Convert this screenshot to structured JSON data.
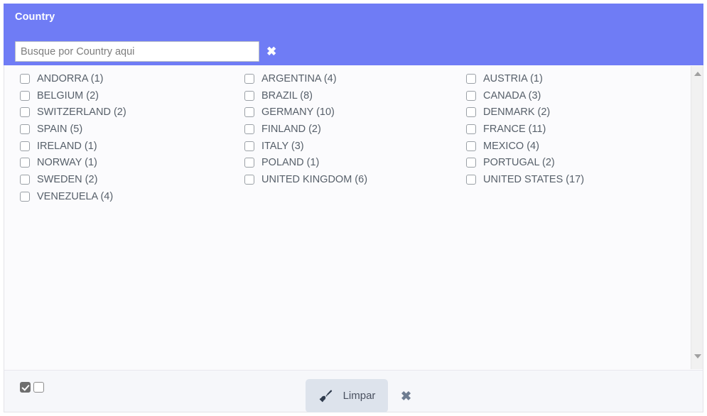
{
  "panel": {
    "title": "Country",
    "accent_color": "#6f7cf5",
    "body_background": "#fbfbfd",
    "footer_background": "#f6f7fa"
  },
  "search": {
    "value": "",
    "placeholder": "Busque por Country aqui",
    "clear_icon": "close-x-icon",
    "clear_icon_glyph": "✖"
  },
  "options": {
    "columns": [
      {
        "items": [
          {
            "label": "ANDORRA (1)",
            "name": "ANDORRA",
            "count": 1,
            "checked": false
          },
          {
            "label": "BELGIUM (2)",
            "name": "BELGIUM",
            "count": 2,
            "checked": false
          },
          {
            "label": "SWITZERLAND (2)",
            "name": "SWITZERLAND",
            "count": 2,
            "checked": false
          },
          {
            "label": "SPAIN (5)",
            "name": "SPAIN",
            "count": 5,
            "checked": false
          },
          {
            "label": "IRELAND (1)",
            "name": "IRELAND",
            "count": 1,
            "checked": false
          },
          {
            "label": "NORWAY (1)",
            "name": "NORWAY",
            "count": 1,
            "checked": false
          },
          {
            "label": "SWEDEN (2)",
            "name": "SWEDEN",
            "count": 2,
            "checked": false
          },
          {
            "label": "VENEZUELA (4)",
            "name": "VENEZUELA",
            "count": 4,
            "checked": false
          }
        ]
      },
      {
        "items": [
          {
            "label": "ARGENTINA (4)",
            "name": "ARGENTINA",
            "count": 4,
            "checked": false
          },
          {
            "label": "BRAZIL (8)",
            "name": "BRAZIL",
            "count": 8,
            "checked": false
          },
          {
            "label": "GERMANY (10)",
            "name": "GERMANY",
            "count": 10,
            "checked": false
          },
          {
            "label": "FINLAND (2)",
            "name": "FINLAND",
            "count": 2,
            "checked": false
          },
          {
            "label": "ITALY (3)",
            "name": "ITALY",
            "count": 3,
            "checked": false
          },
          {
            "label": "POLAND (1)",
            "name": "POLAND",
            "count": 1,
            "checked": false
          },
          {
            "label": "UNITED KINGDOM (6)",
            "name": "UNITED KINGDOM",
            "count": 6,
            "checked": false
          }
        ]
      },
      {
        "items": [
          {
            "label": "AUSTRIA (1)",
            "name": "AUSTRIA",
            "count": 1,
            "checked": false
          },
          {
            "label": "CANADA (3)",
            "name": "CANADA",
            "count": 3,
            "checked": false
          },
          {
            "label": "DENMARK (2)",
            "name": "DENMARK",
            "count": 2,
            "checked": false
          },
          {
            "label": "FRANCE (11)",
            "name": "FRANCE",
            "count": 11,
            "checked": false
          },
          {
            "label": "MEXICO (4)",
            "name": "MEXICO",
            "count": 4,
            "checked": false
          },
          {
            "label": "PORTUGAL (2)",
            "name": "PORTUGAL",
            "count": 2,
            "checked": false
          },
          {
            "label": "UNITED STATES (17)",
            "name": "UNITED STATES",
            "count": 17,
            "checked": false
          }
        ]
      }
    ]
  },
  "scrollbar": {
    "up_icon": "scroll-up-arrow-icon",
    "down_icon": "scroll-down-arrow-icon"
  },
  "footer": {
    "select_all_checkbox": {
      "checked": true
    },
    "select_none_checkbox": {
      "checked": false
    },
    "clear_button": {
      "label": "Limpar",
      "icon": "broom-icon"
    },
    "close_icon": "close-x-icon",
    "close_icon_glyph": "✖"
  }
}
